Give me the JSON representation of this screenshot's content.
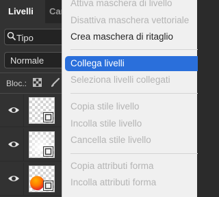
{
  "panel": {
    "tabs": [
      {
        "label": "Livelli"
      },
      {
        "label": "Canali"
      }
    ],
    "filter_label": "Tipo",
    "blend_mode": "Normale",
    "lock_label": "Bloc.:",
    "layers": [
      {
        "visible": true,
        "thumbnail": "blank"
      },
      {
        "visible": true,
        "thumbnail": "soft-white"
      },
      {
        "visible": true,
        "thumbnail": "orange-circle"
      }
    ]
  },
  "menu": {
    "items": [
      {
        "label": "Attiva maschera di livello",
        "enabled": false
      },
      {
        "label": "Disattiva maschera vettoriale",
        "enabled": false
      },
      {
        "label": "Crea maschera di ritaglio",
        "enabled": true
      },
      {
        "label": "Collega livelli",
        "enabled": true,
        "selected": true
      },
      {
        "label": "Seleziona livelli collegati",
        "enabled": false
      },
      {
        "label": "Copia stile livello",
        "enabled": false
      },
      {
        "label": "Incolla stile livello",
        "enabled": false
      },
      {
        "label": "Cancella stile livello",
        "enabled": false
      },
      {
        "label": "Copia attributi forma",
        "enabled": false
      },
      {
        "label": "Incolla attributi forma",
        "enabled": false
      }
    ]
  },
  "colors": {
    "accent": "#2a6fdb",
    "panel_bg": "#323232",
    "menu_bg": "#f0f0f0",
    "disabled_text": "#b4b4b4",
    "thumb_circle_orange": "#ff7a00",
    "thumb_circle_red": "#e3262a"
  }
}
